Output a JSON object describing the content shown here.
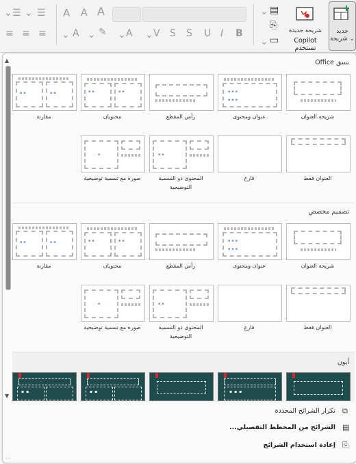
{
  "ribbon": {
    "new_slide": {
      "label_line1": "جديد",
      "label_line2": "شريحة"
    },
    "copilot_slide": {
      "label_line1": "شريحة جديدة",
      "label_line2": "Copilot تستخدم"
    }
  },
  "gallery": {
    "sections": [
      {
        "title": "نسق Office",
        "layouts": [
          {
            "name": "شريحة العنوان"
          },
          {
            "name": "عنوان ومحتوى"
          },
          {
            "name": "رأس المقطع"
          },
          {
            "name": "محتويان"
          },
          {
            "name": "مقارنة"
          },
          {
            "name": "العنوان فقط"
          },
          {
            "name": "فارغ"
          },
          {
            "name": "المحتوى ذو التسمية التوضيحية"
          },
          {
            "name": "صورة مع تسمية توضيحية"
          }
        ]
      },
      {
        "title": "تصميم مخصص",
        "layouts": [
          {
            "name": "شريحة العنوان"
          },
          {
            "name": "عنوان ومحتوى"
          },
          {
            "name": "رأس المقطع"
          },
          {
            "name": "محتويان"
          },
          {
            "name": "مقارنة"
          },
          {
            "name": "العنوان فقط"
          },
          {
            "name": "فارغ"
          },
          {
            "name": "المحتوى ذو التسمية التوضيحية"
          },
          {
            "name": "صورة مع تسمية توضيحية"
          }
        ]
      },
      {
        "title": "أيون",
        "theme_colors": {
          "background": "#1f4d4d",
          "accent": "#d9262e"
        }
      }
    ]
  },
  "menu": {
    "duplicate": "تكرار الشرائح المحددة",
    "from_outline": "الشرائح من المخطط التفصيلي...",
    "reuse": "إعادة استخدام الشرائح"
  }
}
